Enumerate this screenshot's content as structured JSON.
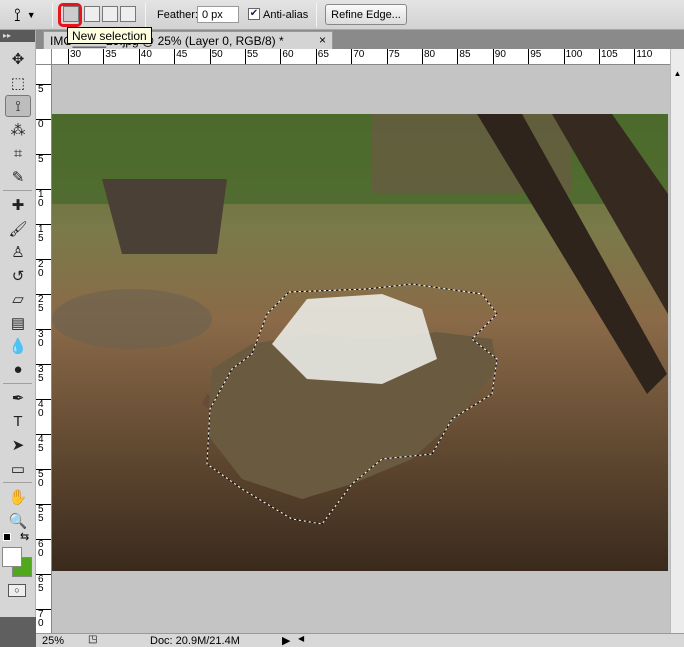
{
  "options_bar": {
    "tool_icon": "polygonal-lasso-icon",
    "feather_label": "Feather:",
    "feather_value": "0 px",
    "anti_alias_label": "Anti-alias",
    "anti_alias_checked": true,
    "refine_edge_label": "Refine Edge...",
    "selection_modes": [
      "new-selection",
      "add-to-selection",
      "subtract-from-selection",
      "intersect-with-selection"
    ],
    "tooltip": "New selection",
    "highlight_color": "#e8141b"
  },
  "tools": [
    {
      "name": "move",
      "glyph": "✥"
    },
    {
      "name": "rectangular-marquee",
      "glyph": "⬚"
    },
    {
      "name": "polygonal-lasso",
      "glyph": "⟟",
      "active": true
    },
    {
      "name": "magic-wand",
      "glyph": "⁂"
    },
    {
      "name": "crop",
      "glyph": "⌗"
    },
    {
      "name": "eyedropper",
      "glyph": "✎"
    },
    {
      "name": "spot-healing",
      "glyph": "✚"
    },
    {
      "name": "brush",
      "glyph": "🖌"
    },
    {
      "name": "clone-stamp",
      "glyph": "♙"
    },
    {
      "name": "history-brush",
      "glyph": "↺"
    },
    {
      "name": "eraser",
      "glyph": "▱"
    },
    {
      "name": "gradient",
      "glyph": "▤"
    },
    {
      "name": "blur",
      "glyph": "💧"
    },
    {
      "name": "dodge",
      "glyph": "●"
    },
    {
      "name": "pen",
      "glyph": "✒"
    },
    {
      "name": "type",
      "glyph": "T"
    },
    {
      "name": "path-selection",
      "glyph": "➤"
    },
    {
      "name": "rectangle-shape",
      "glyph": "▭"
    },
    {
      "name": "hand",
      "glyph": "✋"
    },
    {
      "name": "zoom",
      "glyph": "🔍"
    }
  ],
  "colors": {
    "foreground": "#ffffff",
    "background": "#52a81c"
  },
  "document": {
    "tab_title": "IMG_____29.jpg @ 25% (Layer 0, RGB/8) *",
    "close": "×"
  },
  "rulers": {
    "horizontal": [
      "30",
      "35",
      "40",
      "45",
      "50",
      "55",
      "60",
      "65",
      "70",
      "75",
      "80",
      "85",
      "90",
      "95",
      "100",
      "105",
      "110"
    ],
    "vertical": [
      "5",
      "0",
      "5",
      "10",
      "15",
      "20",
      "25",
      "30",
      "35",
      "40",
      "45",
      "50",
      "55",
      "60",
      "65",
      "70"
    ]
  },
  "status": {
    "zoom": "25%",
    "doc_size": "Doc: 20.9M/21.4M"
  }
}
